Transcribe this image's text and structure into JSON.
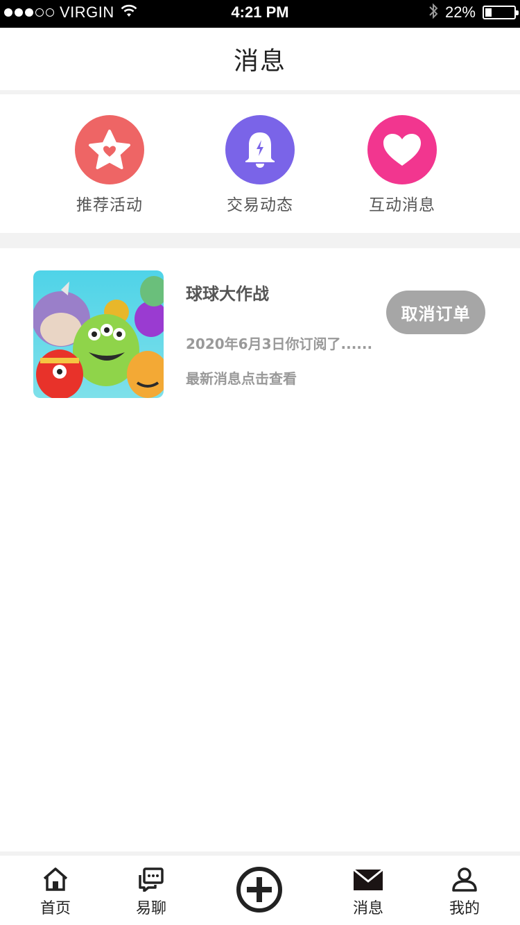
{
  "status_bar": {
    "carrier": "VIRGIN",
    "time": "4:21 PM",
    "battery_percent": "22%",
    "battery_level": 0.22,
    "signal_bars_filled": 3,
    "signal_bars_total": 5,
    "icons": [
      "wifi-icon",
      "bluetooth-icon",
      "battery-icon"
    ]
  },
  "header": {
    "title": "消息"
  },
  "categories": [
    {
      "label": "推荐活动",
      "icon": "star-heart-icon",
      "color": "#ee6565"
    },
    {
      "label": "交易动态",
      "icon": "bell-icon",
      "color": "#7a64e8"
    },
    {
      "label": "互动消息",
      "icon": "heart-icon",
      "color": "#f2368f"
    }
  ],
  "messages": [
    {
      "title": "球球大作战",
      "date_text": "2020年6月3日你订阅了......",
      "subtitle": "最新消息点击查看",
      "action_label": "取消订单",
      "thumbnail": "game-monsters-thumbnail"
    }
  ],
  "bottom_nav": {
    "items": [
      {
        "label": "首页",
        "icon": "home-icon"
      },
      {
        "label": "易聊",
        "icon": "chat-icon"
      },
      {
        "label": "",
        "icon": "plus-circle-icon"
      },
      {
        "label": "消息",
        "icon": "mail-icon"
      },
      {
        "label": "我的",
        "icon": "user-icon"
      }
    ]
  },
  "colors": {
    "accent_red": "#ee6565",
    "accent_purple": "#7a64e8",
    "accent_pink": "#f2368f",
    "button_gray": "#a6a6a6"
  }
}
